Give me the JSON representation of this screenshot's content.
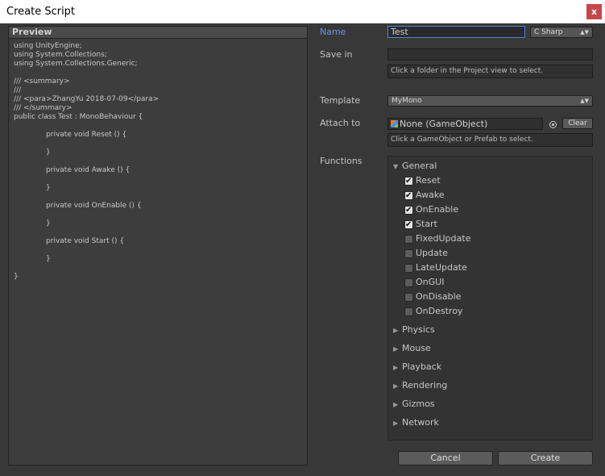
{
  "window": {
    "title": "Create Script",
    "close": "x"
  },
  "preview": {
    "title": "Preview",
    "lines": [
      "using UnityEngine;",
      "using System.Collections;",
      "using System.Collections.Generic;",
      "",
      "/// <summary>",
      "///",
      "/// <para>ZhangYu 2018-07-09</para>",
      "/// </summary>",
      "public class Test : MonoBehaviour {",
      "",
      "              private void Reset () {",
      "",
      "              }",
      "",
      "              private void Awake () {",
      "",
      "              }",
      "",
      "              private void OnEnable () {",
      "",
      "              }",
      "",
      "              private void Start () {",
      "",
      "              }",
      "",
      "}"
    ]
  },
  "form": {
    "name_label": "Name",
    "name_value": "Test",
    "language": "C Sharp",
    "savein_label": "Save in",
    "savein_value": "",
    "savein_hint": "Click a folder in the Project view to select.",
    "template_label": "Template",
    "template_value": "MyMono",
    "attach_label": "Attach to",
    "attach_value": "None (GameObject)",
    "clear_label": "Clear",
    "attach_hint": "Click a GameObject or Prefab to select.",
    "functions_label": "Functions"
  },
  "functions": {
    "general": {
      "label": "General",
      "items": [
        {
          "label": "Reset",
          "checked": true
        },
        {
          "label": "Awake",
          "checked": true
        },
        {
          "label": "OnEnable",
          "checked": true
        },
        {
          "label": "Start",
          "checked": true
        },
        {
          "label": "FixedUpdate",
          "checked": false
        },
        {
          "label": "Update",
          "checked": false
        },
        {
          "label": "LateUpdate",
          "checked": false
        },
        {
          "label": "OnGUI",
          "checked": false
        },
        {
          "label": "OnDisable",
          "checked": false
        },
        {
          "label": "OnDestroy",
          "checked": false
        }
      ]
    },
    "collapsed": [
      "Physics",
      "Mouse",
      "Playback",
      "Rendering",
      "Gizmos",
      "Network"
    ]
  },
  "buttons": {
    "cancel": "Cancel",
    "create": "Create"
  },
  "icons": {
    "expanded": "triangle-down-icon",
    "collapsed": "triangle-right-icon",
    "check": "checkmark-icon"
  }
}
